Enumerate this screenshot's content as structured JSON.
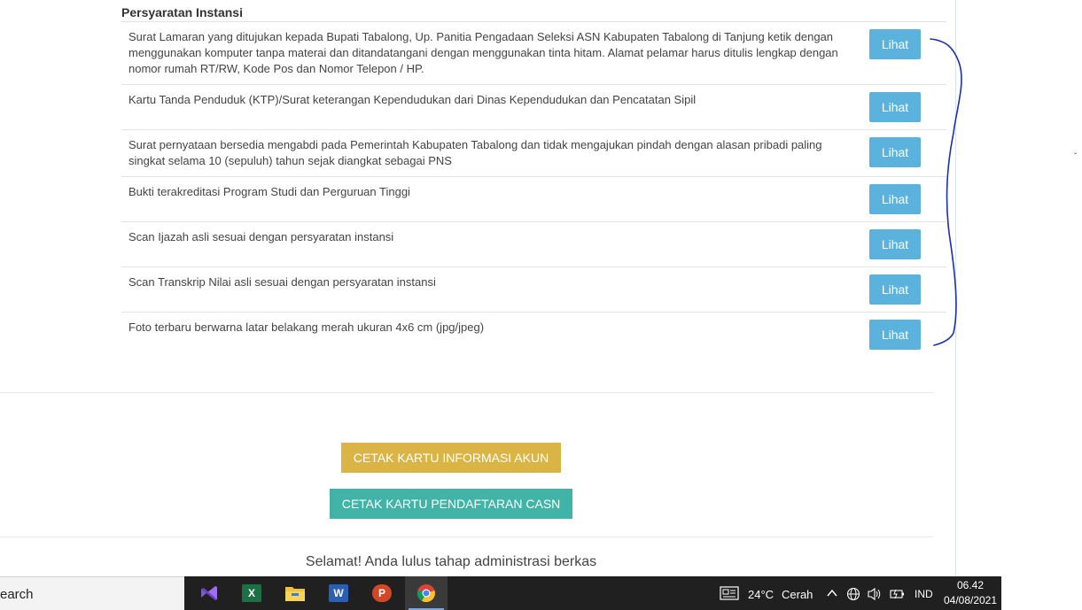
{
  "section": {
    "title": "Persyaratan Instansi"
  },
  "requirements": [
    {
      "text": "Surat Lamaran yang ditujukan kepada Bupati Tabalong, Up. Panitia Pengadaan Seleksi ASN Kabupaten Tabalong di Tanjung ketik dengan menggunakan komputer tanpa materai dan ditandatangani dengan menggunakan tinta hitam. Alamat pelamar harus ditulis lengkap dengan nomor rumah RT/RW, Kode Pos dan Nomor Telepon / HP.",
      "button": "Lihat"
    },
    {
      "text": "Kartu Tanda Penduduk (KTP)/Surat keterangan Kependudukan dari Dinas Kependudukan dan Pencatatan Sipil",
      "button": "Lihat"
    },
    {
      "text": "Surat pernyataan bersedia mengabdi pada Pemerintah Kabupaten Tabalong dan tidak mengajukan pindah dengan alasan pribadi paling singkat selama 10 (sepuluh) tahun sejak diangkat sebagai PNS",
      "button": "Lihat"
    },
    {
      "text": "Bukti terakreditasi Program Studi dan Perguruan Tinggi",
      "button": "Lihat"
    },
    {
      "text": "Scan Ijazah asli sesuai dengan persyaratan instansi",
      "button": "Lihat"
    },
    {
      "text": "Scan Transkrip Nilai asli sesuai dengan persyaratan instansi",
      "button": "Lihat"
    },
    {
      "text": "Foto terbaru berwarna latar belakang merah ukuran 4x6 cm (jpg/jpeg)",
      "button": "Lihat"
    }
  ],
  "actions": {
    "print_account_info": "CETAK KARTU INFORMASI AKUN",
    "print_registration": "CETAK KARTU PENDAFTARAN CASN"
  },
  "status_message": "Selamat! Anda lulus tahap administrasi berkas",
  "annotation": {
    "margin_mark": "ˇ"
  },
  "taskbar": {
    "search_text": "earch",
    "apps": [
      {
        "name": "visual-studio",
        "label": ""
      },
      {
        "name": "excel",
        "label": "X"
      },
      {
        "name": "file-explorer",
        "label": ""
      },
      {
        "name": "word",
        "label": "W"
      },
      {
        "name": "powerpoint",
        "label": "P"
      },
      {
        "name": "chrome",
        "label": ""
      }
    ],
    "weather": {
      "temp": "24°C",
      "condition": "Cerah"
    },
    "language": "IND",
    "time": "06.42",
    "date": "04/08/2021"
  },
  "colors": {
    "lihat": "#5bb2dd",
    "gold": "#dbb446",
    "teal": "#41b4a7",
    "annotation": "#1a2fb5"
  }
}
